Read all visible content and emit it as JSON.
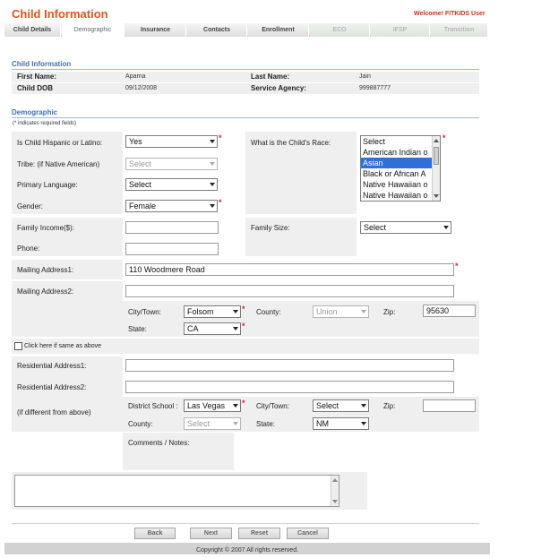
{
  "header": {
    "title": "Child Information",
    "welcome": "Welcome! FITKIDS User"
  },
  "tabs": [
    {
      "label": "Child Details",
      "state": "normal"
    },
    {
      "label": "Demographic",
      "state": "active"
    },
    {
      "label": "Insurance",
      "state": "normal"
    },
    {
      "label": "Contacts",
      "state": "normal"
    },
    {
      "label": "Enrollment",
      "state": "normal"
    },
    {
      "label": "ECO",
      "state": "disabled"
    },
    {
      "label": "IFSP",
      "state": "disabled"
    },
    {
      "label": "Transition",
      "state": "disabled"
    }
  ],
  "child_info": {
    "title": "Child Information",
    "first_name_label": "First Name:",
    "first_name": "Aparna",
    "last_name_label": "Last Name:",
    "last_name": "Jain",
    "dob_label": "Child DOB",
    "dob": "09/12/2008",
    "agency_label": "Service Agency:",
    "agency": "999887777"
  },
  "demographic": {
    "title": "Demographic",
    "required_note_star": "(*",
    "required_note": " indicates required fields)",
    "hispanic_label": "Is Child Hispanic or Latino:",
    "hispanic_value": "Yes",
    "tribe_label": "Tribe: (if Native American)",
    "tribe_value": "Select",
    "language_label": "Primary Language:",
    "language_value": "Select",
    "gender_label": "Gender:",
    "gender_value": "Female",
    "race_label": "What is the Child's Race:",
    "race_options": [
      "Select",
      "American Indian o",
      "Asian",
      "Black or African A",
      "Native Hawaiian o",
      "Native Hawaiian o"
    ],
    "race_selected": 2,
    "income_label": "Family Income($):",
    "income_value": "",
    "family_size_label": "Family Size:",
    "family_size_value": "Select",
    "phone_label": "Phone:",
    "phone_value": "",
    "mailing1_label": "Mailing Address1:",
    "mailing1_value": "110 Woodmere Road",
    "mailing2_label": "Mailing Address2:",
    "mailing2_value": "",
    "city_label": "City/Town:",
    "city_value": "Folsom",
    "county_label": "County:",
    "county_value": "Union",
    "zip_label": "Zip:",
    "zip_value": "95630",
    "state_label": "State:",
    "state_value": "CA",
    "same_as_above_label": "Click here if same as above",
    "res1_label": "Residential Address1:",
    "res1_value": "",
    "res2_label": "Residential Address2:",
    "res2_value": "",
    "if_different_label": "(if different from above)",
    "district_label": "District School :",
    "district_value": "Las Vegas",
    "res_city_label": "City/Town:",
    "res_city_value": "Select",
    "res_zip_label": "Zip:",
    "res_zip_value": "",
    "res_county_label": "County:",
    "res_county_value": "Select",
    "res_state_label": "State:",
    "res_state_value": "NM",
    "comments_label": "Comments / Notes:",
    "comments_value": "",
    "required_star": "*"
  },
  "buttons": {
    "back": "Back",
    "next": "Next",
    "reset": "Reset",
    "cancel": "Cancel"
  },
  "footer": "Copyright © 2007 All rights reserved."
}
